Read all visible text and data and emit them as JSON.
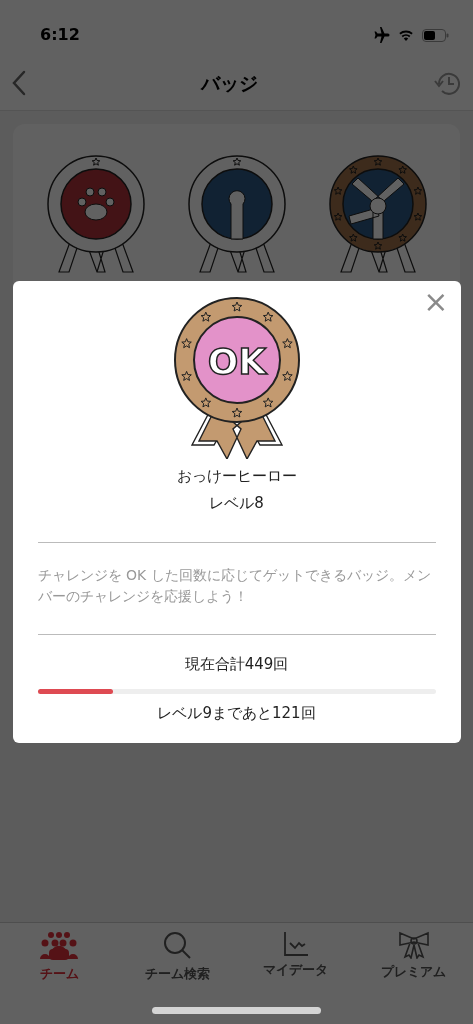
{
  "status_bar": {
    "time": "6:12"
  },
  "nav": {
    "title": "バッジ"
  },
  "badges": [
    {
      "kind": "paw"
    },
    {
      "kind": "raised-arm"
    },
    {
      "kind": "crossed-arms"
    }
  ],
  "dialog": {
    "close": "×",
    "badge_label": "OK",
    "name": "おっけーヒーロー",
    "level_text": "レベル8",
    "description": "チャレンジを OK した回数に応じてゲットできるバッジ。メンバーのチャレンジを応援しよう！",
    "total": "現在合計449回",
    "progress": {
      "level": 0.19
    },
    "remaining": "レベル9まであと121回"
  },
  "tabs": [
    {
      "label": "チーム",
      "selected": true
    },
    {
      "label": "チーム検索",
      "selected": false
    },
    {
      "label": "マイデータ",
      "selected": false
    },
    {
      "label": "プレミアム",
      "selected": false
    }
  ]
}
